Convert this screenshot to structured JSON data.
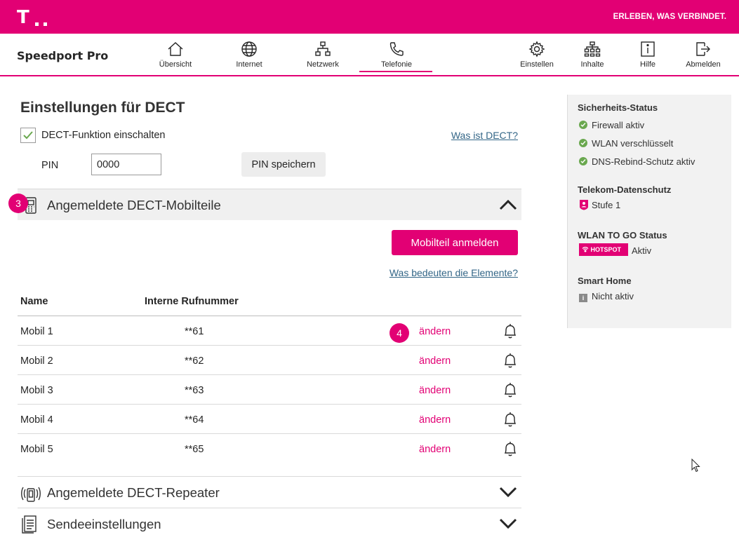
{
  "header": {
    "logo": "T",
    "slogan": "ERLEBEN, WAS VERBINDET.",
    "brand": "Speedport Pro",
    "accent_color": "#e20074"
  },
  "nav": {
    "left": [
      {
        "label": "Übersicht",
        "icon": "home-icon"
      },
      {
        "label": "Internet",
        "icon": "globe-icon"
      },
      {
        "label": "Netzwerk",
        "icon": "network-icon"
      },
      {
        "label": "Telefonie",
        "icon": "phone-icon",
        "active": true
      }
    ],
    "right": [
      {
        "label": "Einstellen",
        "icon": "gear-icon"
      },
      {
        "label": "Inhalte",
        "icon": "sitemap-icon"
      },
      {
        "label": "Hilfe",
        "icon": "info-icon"
      },
      {
        "label": "Abmelden",
        "icon": "logout-icon"
      }
    ]
  },
  "main": {
    "title": "Einstellungen für DECT",
    "dect_toggle_label": "DECT-Funktion einschalten",
    "dect_toggle_checked": true,
    "what_is_dect_link": "Was ist DECT?",
    "pin_label": "PIN",
    "pin_value": "0000",
    "pin_save_button": "PIN speichern",
    "section_handsets": "Angemeldete DECT-Mobilteile",
    "badge_3": "3",
    "badge_4": "4",
    "register_button": "Mobilteil anmelden",
    "elements_link": "Was bedeuten die Elemente?",
    "table": {
      "col_name": "Name",
      "col_number": "Interne Rufnummer",
      "rows": [
        {
          "name": "Mobil 1",
          "number": "**61",
          "edit": "ändern"
        },
        {
          "name": "Mobil 2",
          "number": "**62",
          "edit": "ändern"
        },
        {
          "name": "Mobil 3",
          "number": "**63",
          "edit": "ändern"
        },
        {
          "name": "Mobil 4",
          "number": "**64",
          "edit": "ändern"
        },
        {
          "name": "Mobil 5",
          "number": "**65",
          "edit": "ändern"
        }
      ]
    },
    "section_repeater": "Angemeldete DECT-Repeater",
    "section_send": "Sendeeinstellungen"
  },
  "sidebar": {
    "security_title": "Sicherheits-Status",
    "security_items": [
      "Firewall aktiv",
      "WLAN verschlüsselt",
      "DNS-Rebind-Schutz aktiv"
    ],
    "privacy_title": "Telekom-Datenschutz",
    "privacy_value": "Stufe 1",
    "wlan_togo_title": "WLAN TO GO Status",
    "hotspot_label": "HOTSPOT",
    "wlan_togo_value": "Aktiv",
    "smarthome_title": "Smart Home",
    "smarthome_value": "Nicht aktiv",
    "status_ok_color": "#6aa84f"
  }
}
